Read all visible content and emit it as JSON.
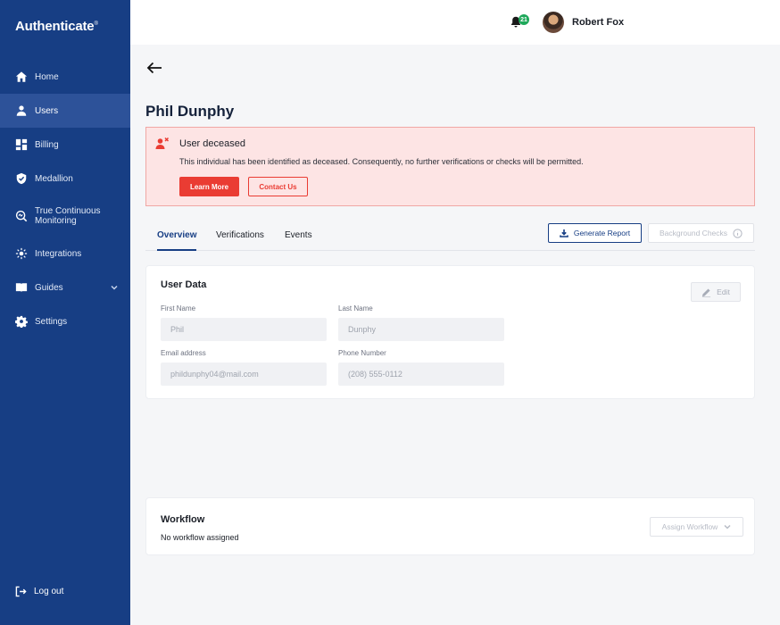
{
  "app": {
    "logo": "Authenticate",
    "logo_mark": "®"
  },
  "sidebar": {
    "items": [
      {
        "label": "Home",
        "icon": "home-icon"
      },
      {
        "label": "Users",
        "icon": "user-icon",
        "active": true
      },
      {
        "label": "Billing",
        "icon": "billing-icon"
      },
      {
        "label": "Medallion",
        "icon": "shield-icon"
      },
      {
        "label": "True Continuous Monitoring",
        "icon": "monitoring-icon"
      },
      {
        "label": "Integrations",
        "icon": "integrations-icon"
      },
      {
        "label": "Guides",
        "icon": "book-icon",
        "has_chevron": true
      },
      {
        "label": "Settings",
        "icon": "gear-icon"
      }
    ],
    "logout": "Log out"
  },
  "header": {
    "notification_count": "21",
    "user_name": "Robert Fox"
  },
  "page": {
    "title": "Phil Dunphy"
  },
  "alert": {
    "title": "User deceased",
    "message": "This individual has been identified as deceased. Consequently, no further verifications or checks will be permitted.",
    "learn_more": "Learn More",
    "contact_us": "Contact Us"
  },
  "tabs": [
    {
      "label": "Overview",
      "active": true
    },
    {
      "label": "Verifications"
    },
    {
      "label": "Events"
    }
  ],
  "actions": {
    "generate_report": "Generate Report",
    "background_checks": "Background Checks"
  },
  "user_data": {
    "title": "User Data",
    "edit": "Edit",
    "first_name_label": "First Name",
    "first_name": "Phil",
    "last_name_label": "Last Name",
    "last_name": "Dunphy",
    "email_label": "Email address",
    "email": "phildunphy04@mail.com",
    "phone_label": "Phone Number",
    "phone": "(208) 555-0112"
  },
  "workflow": {
    "title": "Workflow",
    "status": "No workflow assigned",
    "assign": "Assign Workflow"
  },
  "colors": {
    "sidebar": "#173e84",
    "sidebar_active": "#2d5299",
    "alert_bg": "#fde4e4",
    "danger": "#ea3c33",
    "notification": "#1ea85a"
  }
}
